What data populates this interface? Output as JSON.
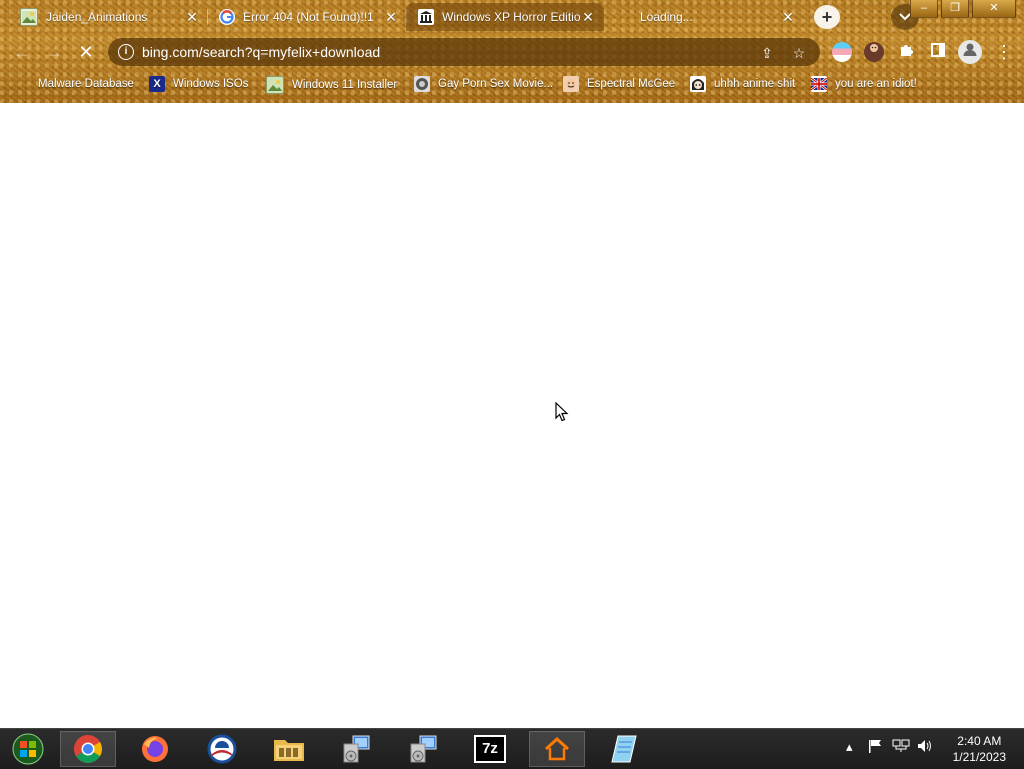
{
  "tabs": [
    {
      "title": "Jaiden_Animations",
      "favicon": "image-thumbnail-icon"
    },
    {
      "title": "Error 404 (Not Found)!!1",
      "favicon": "google-g-icon"
    },
    {
      "title": "Windows XP Horror Editio",
      "favicon": "museum-icon"
    },
    {
      "title": "Loading...",
      "favicon": "loading-icon"
    }
  ],
  "window": {
    "minimize": "–",
    "maximize": "❐",
    "close": "✕"
  },
  "toolbar": {
    "url": "bing.com/search?q=myfelix+download",
    "back_icon": "←",
    "forward_icon": "→",
    "stop_icon": "✕",
    "info_icon": "i",
    "share_icon": "⇪",
    "star_icon": "☆",
    "newtab_icon": "+",
    "tabsearch_icon": "⌄",
    "menu_icon": "⋮"
  },
  "bookmarks": [
    {
      "label": "Malware Database"
    },
    {
      "label": "Windows ISOs"
    },
    {
      "label": "Windows 11 Installer"
    },
    {
      "label": "Gay Porn Sex Movie..."
    },
    {
      "label": "Espectral McGee"
    },
    {
      "label": "uhhh anime shit"
    },
    {
      "label": "you are an idiot!"
    }
  ],
  "taskbar": {
    "apps": [
      "start",
      "chrome",
      "firefox",
      "obama",
      "file-explorer",
      "installer-1",
      "installer-2",
      "7zip",
      "home-app",
      "notepad"
    ],
    "sevenzip_label": "7z",
    "tray_chevron": "▴",
    "time": "2:40 AM",
    "date": "1/21/2023"
  },
  "colors": {
    "theme": "#b57a1e",
    "taskbar": "#1d1d1d",
    "content": "#ffffff"
  }
}
